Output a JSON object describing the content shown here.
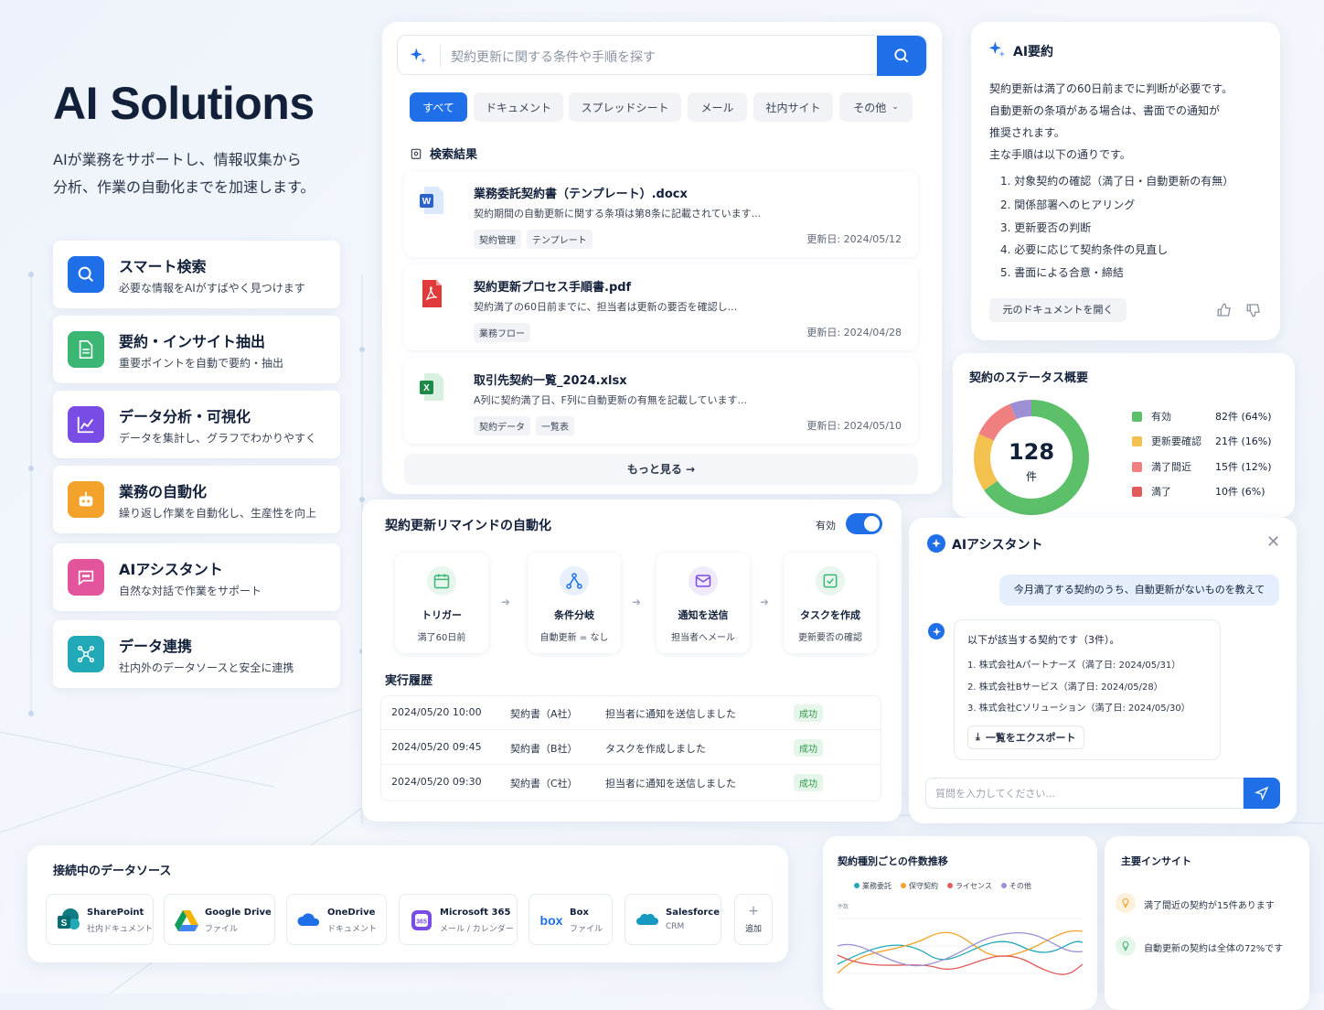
{
  "hero": {
    "title": "AI Solutions",
    "subtitle_line1": "AIが業務をサポートし、情報収集から",
    "subtitle_line2": "分析、作業の自動化までを加速します。"
  },
  "features": [
    {
      "title": "スマート検索",
      "desc": "必要な情報をAIがすばやく見つけます",
      "icon": "search-icon",
      "color": "#1f6fe8"
    },
    {
      "title": "要約・インサイト抽出",
      "desc": "重要ポイントを自動で要約・抽出",
      "icon": "document-icon",
      "color": "#3bb673"
    },
    {
      "title": "データ分析・可視化",
      "desc": "データを集計し、グラフでわかりやすく",
      "icon": "chart-icon",
      "color": "#7a4ce6"
    },
    {
      "title": "業務の自動化",
      "desc": "繰り返し作業を自動化し、生産性を向上",
      "icon": "robot-icon",
      "color": "#f3a32c"
    },
    {
      "title": "AIアシスタント",
      "desc": "自然な対話で作業をサポート",
      "icon": "chat-icon",
      "color": "#e2549b"
    },
    {
      "title": "データ連携",
      "desc": "社内外のデータソースと安全に連携",
      "icon": "network-icon",
      "color": "#21a9b8"
    }
  ],
  "search": {
    "placeholder": "契約更新に関する条件や手順を探す",
    "filters": [
      "すべて",
      "ドキュメント",
      "スプレッドシート",
      "メール",
      "社内サイト",
      "その他"
    ],
    "results_heading": "検索結果",
    "results": [
      {
        "name": "業務委託契約書（テンプレート）.docx",
        "snippet": "契約期間の自動更新に関する条項は第8条に記載されています...",
        "tags": [
          "契約管理",
          "テンプレート"
        ],
        "date": "更新日: 2024/05/12",
        "icon": "word-file-icon"
      },
      {
        "name": "契約更新プロセス手順書.pdf",
        "snippet": "契約満了の60日前までに、担当者は更新の要否を確認し...",
        "tags": [
          "業務フロー"
        ],
        "date": "更新日: 2024/04/28",
        "icon": "pdf-file-icon"
      },
      {
        "name": "取引先契約一覧_2024.xlsx",
        "snippet": "A列に契約満了日、F列に自動更新の有無を記載しています...",
        "tags": [
          "契約データ",
          "一覧表"
        ],
        "date": "更新日: 2024/05/10",
        "icon": "excel-file-icon"
      }
    ],
    "more": "もっと見る →"
  },
  "summary": {
    "title": "AI要約",
    "lines": [
      "契約更新は満了の60日前までに判断が必要です。",
      "自動更新の条項がある場合は、書面での通知が",
      "推奨されます。",
      "主な手順は以下の通りです。"
    ],
    "steps": [
      "1.  対象契約の確認（満了日・自動更新の有無）",
      "2.  関係部署へのヒアリング",
      "3.  更新要否の判断",
      "4.  必要に応じて契約条件の見直し",
      "5.  書面による合意・締結"
    ],
    "open_doc": "元のドキュメントを開く"
  },
  "status": {
    "title": "契約のステータス概要",
    "total": "128",
    "unit": "件",
    "items": [
      {
        "label": "有効",
        "value": "82件 (64%)",
        "pct": 64,
        "color": "#5cbf6a"
      },
      {
        "label": "更新要確認",
        "value": "21件 (16%)",
        "pct": 16,
        "color": "#f2c14e"
      },
      {
        "label": "満了間近",
        "value": "15件 (12%)",
        "pct": 12,
        "color": "#f08080"
      },
      {
        "label": "満了",
        "value": "10件 (6%)",
        "pct": 6,
        "color": "#9d8fd4"
      }
    ]
  },
  "automation": {
    "title": "契約更新リマインドの自動化",
    "toggle_label": "有効",
    "steps": [
      {
        "title": "トリガー",
        "desc": "満了60日前",
        "icon": "calendar-icon",
        "color": "#3bb673"
      },
      {
        "title": "条件分岐",
        "desc": "自動更新 = なし",
        "icon": "branch-icon",
        "color": "#1f6fe8"
      },
      {
        "title": "通知を送信",
        "desc": "担当者へメール",
        "icon": "mail-icon",
        "color": "#7a4ce6"
      },
      {
        "title": "タスクを作成",
        "desc": "更新要否の確認",
        "icon": "checkbox-icon",
        "color": "#3bb673"
      }
    ],
    "history_title": "実行履歴",
    "history": [
      {
        "time": "2024/05/20 10:00",
        "doc": "契約書（A社）",
        "action": "担当者に通知を送信しました",
        "status": "成功"
      },
      {
        "time": "2024/05/20 09:45",
        "doc": "契約書（B社）",
        "action": "タスクを作成しました",
        "status": "成功"
      },
      {
        "time": "2024/05/20 09:30",
        "doc": "契約書（C社）",
        "action": "担当者に通知を送信しました",
        "status": "成功"
      }
    ]
  },
  "assistant": {
    "title": "AIアシスタント",
    "user_msg": "今月満了する契約のうち、自動更新がないものを教えて",
    "reply_intro": "以下が該当する契約です（3件）。",
    "reply_items": [
      "1.  株式会社Aパートナーズ（満了日: 2024/05/31）",
      "2.  株式会社Bサービス（満了日: 2024/05/28）",
      "3.  株式会社Cソリューション（満了日: 2024/05/30）"
    ],
    "export": "一覧をエクスポート",
    "input_placeholder": "質問を入力してください..."
  },
  "datasources": {
    "title": "接続中のデータソース",
    "items": [
      {
        "name": "SharePoint",
        "sub": "社内ドキュメント",
        "icon": "sharepoint-icon",
        "color": "#0f7b83"
      },
      {
        "name": "Google Drive",
        "sub": "ファイル",
        "icon": "google-drive-icon",
        "color": "#f4b400"
      },
      {
        "name": "OneDrive",
        "sub": "ドキュメント",
        "icon": "onedrive-icon",
        "color": "#1f6fe8"
      },
      {
        "name": "Microsoft 365",
        "sub": "メール / カレンダー",
        "icon": "microsoft365-icon",
        "color": "#7a4ce6"
      },
      {
        "name": "Box",
        "sub": "ファイル",
        "icon": "box-icon",
        "color": "#1f6fe8"
      },
      {
        "name": "Salesforce",
        "sub": "CRM",
        "icon": "salesforce-icon",
        "color": "#1798c1"
      }
    ],
    "add": "追加"
  },
  "trend": {
    "title": "契約種別ごとの件数推移",
    "legend": [
      {
        "name": "業務委託",
        "color": "#21a9b8"
      },
      {
        "name": "保守契約",
        "color": "#f3a32c"
      },
      {
        "name": "ライセンス",
        "color": "#e05b5b"
      },
      {
        "name": "その他",
        "color": "#9d8fd4"
      }
    ],
    "ytick": "件数"
  },
  "insights": {
    "title": "主要インサイト",
    "items": [
      {
        "text": "満了間近の契約が15件あります",
        "icon": "lightbulb-icon",
        "color": "#f3a32c"
      },
      {
        "text": "自動更新の契約は全体の72%です",
        "icon": "lightbulb-icon",
        "color": "#3bb673"
      }
    ]
  }
}
